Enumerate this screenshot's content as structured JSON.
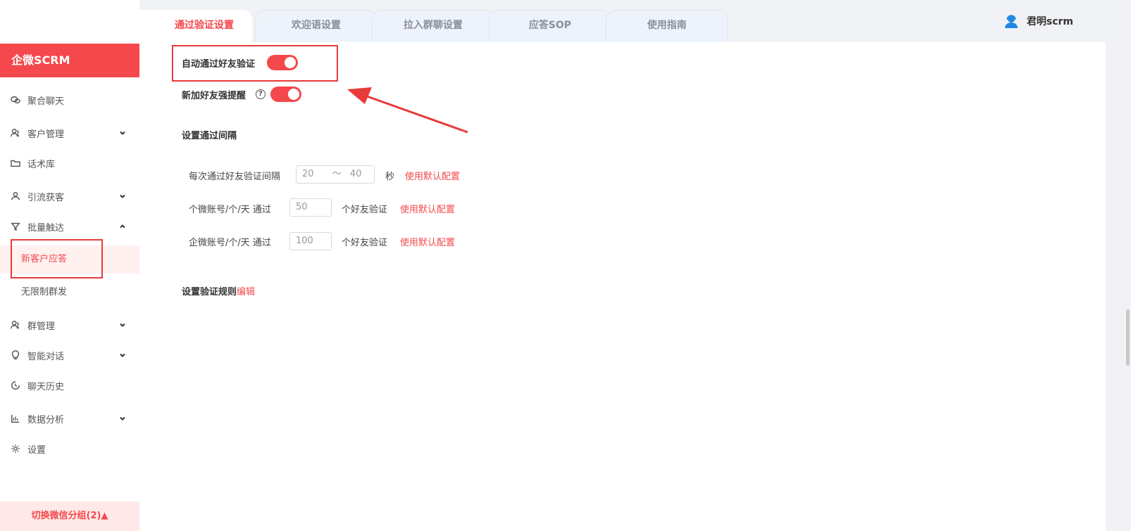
{
  "sidebar": {
    "brand": "企微SCRM",
    "items": [
      {
        "label": "聚合聊天",
        "icon": "wechat-icon"
      },
      {
        "label": "客户管理",
        "icon": "users-icon"
      },
      {
        "label": "话术库",
        "icon": "folder-icon"
      },
      {
        "label": "引流获客",
        "icon": "user-icon"
      },
      {
        "label": "批量触达",
        "icon": "funnel-icon"
      },
      {
        "label": "群管理",
        "icon": "group-icon"
      },
      {
        "label": "智能对话",
        "icon": "bulb-icon"
      },
      {
        "label": "聊天历史",
        "icon": "clock-icon"
      },
      {
        "label": "数据分析",
        "icon": "chart-icon"
      },
      {
        "label": "设置",
        "icon": "gear-icon"
      }
    ],
    "sub_items": [
      {
        "label": "新客户应答",
        "active": true
      },
      {
        "label": "无限制群发",
        "active": false
      }
    ],
    "footer": "切换微信分组(2)▲"
  },
  "tabs": [
    {
      "label": "通过验证设置",
      "active": true
    },
    {
      "label": "欢迎语设置",
      "active": false
    },
    {
      "label": "拉入群聊设置",
      "active": false
    },
    {
      "label": "应答SOP",
      "active": false
    },
    {
      "label": "使用指南",
      "active": false
    }
  ],
  "user": {
    "name": "君明scrm"
  },
  "settings": {
    "auto_accept_label": "自动通过好友验证",
    "auto_accept_on": true,
    "strong_reminder_label": "新加好友强提醒",
    "strong_reminder_on": true,
    "help_glyph": "?",
    "interval_title": "设置通过间隔",
    "interval_label": "每次通过好友验证间隔",
    "interval_min": "20",
    "interval_sep": "～",
    "interval_max": "40",
    "interval_unit": "秒",
    "personal_label": "个微账号/个/天 通过",
    "personal_value": "50",
    "enterprise_label": "企微账号/个/天 通过",
    "enterprise_value": "100",
    "friend_verify_suffix": "个好友验证",
    "default_link": "使用默认配置",
    "rules_title": "设置验证规则",
    "rules_edit": "编辑"
  },
  "colors": {
    "accent": "#f5484c",
    "annotation": "#e83a3a"
  }
}
